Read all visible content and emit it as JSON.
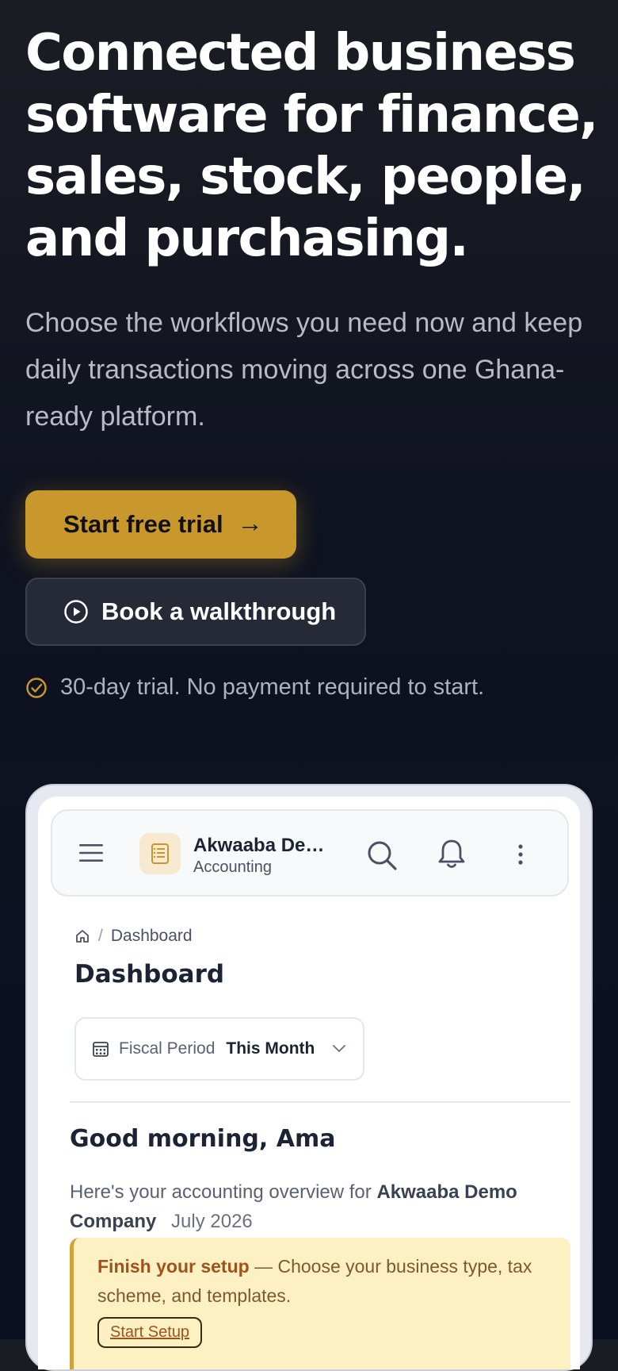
{
  "hero": {
    "title": "Connected business software for finance, sales, stock, people, and purchasing.",
    "subtitle": "Choose the workflows you need now and keep daily transactions moving across one Ghana-ready platform.",
    "primary_cta": "Start free trial",
    "secondary_cta": "Book a walkthrough",
    "trial_note": "30-day trial. No payment required to start."
  },
  "colors": {
    "accent": "#c9982d",
    "background": "#0f1320",
    "setup_bg": "#fdf0c2"
  },
  "app": {
    "company_name": "Akwaaba De…",
    "module": "Accounting",
    "icons": [
      "menu-icon",
      "ledger-icon",
      "search-icon",
      "bell-icon",
      "kebab-icon"
    ],
    "breadcrumb": {
      "current": "Dashboard"
    },
    "page_title": "Dashboard",
    "period": {
      "label": "Fiscal Period",
      "value": "This Month"
    },
    "greeting": "Good morning, Ama",
    "overview": {
      "prefix": "Here's your accounting overview for",
      "company": "Akwaaba Demo Company",
      "month": "July 2026"
    },
    "setup": {
      "title": "Finish your setup",
      "text": "— Choose your business type, tax scheme, and templates.",
      "button": "Start Setup"
    }
  }
}
